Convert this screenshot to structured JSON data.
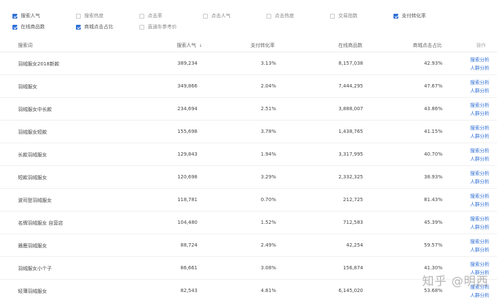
{
  "filters": [
    {
      "label": "搜索人气",
      "checked": true
    },
    {
      "label": "搜索热度",
      "checked": false
    },
    {
      "label": "点击率",
      "checked": false
    },
    {
      "label": "点击人气",
      "checked": false
    },
    {
      "label": "点击热度",
      "checked": false
    },
    {
      "label": "交易指数",
      "checked": false
    },
    {
      "label": "支付转化率",
      "checked": true
    },
    {
      "label": "在线商品数",
      "checked": true
    },
    {
      "label": "商城点击占比",
      "checked": true
    },
    {
      "label": "直通车参考价",
      "checked": false
    }
  ],
  "table": {
    "headers": {
      "keyword": "搜索词",
      "popularity": "搜索人气",
      "conversion": "支付转化率",
      "online_items": "在线商品数",
      "mall_click": "商城点击占比",
      "ops": "操作"
    },
    "rows": [
      {
        "keyword": "羽绒服女2018新款",
        "popularity": "389,234",
        "conversion": "3.13%",
        "online_items": "8,157,038",
        "mall_click": "42.93%"
      },
      {
        "keyword": "羽绒服女",
        "popularity": "349,866",
        "conversion": "2.04%",
        "online_items": "7,444,295",
        "mall_click": "47.67%"
      },
      {
        "keyword": "羽绒服女中长款",
        "popularity": "234,694",
        "conversion": "2.51%",
        "online_items": "3,888,007",
        "mall_click": "43.86%"
      },
      {
        "keyword": "羽绒服女短款",
        "popularity": "155,698",
        "conversion": "3.78%",
        "online_items": "1,438,765",
        "mall_click": "41.15%"
      },
      {
        "keyword": "长款羽绒服女",
        "popularity": "129,843",
        "conversion": "1.94%",
        "online_items": "3,317,995",
        "mall_click": "40.70%"
      },
      {
        "keyword": "短款羽绒服女",
        "popularity": "120,698",
        "conversion": "3.29%",
        "online_items": "2,332,325",
        "mall_click": "38.93%"
      },
      {
        "keyword": "波司登羽绒服女",
        "popularity": "118,781",
        "conversion": "0.70%",
        "online_items": "212,725",
        "mall_click": "81.43%"
      },
      {
        "keyword": "名牌羽绒服女 自营店",
        "popularity": "104,480",
        "conversion": "1.52%",
        "online_items": "712,583",
        "mall_click": "45.39%"
      },
      {
        "keyword": "雅鹿羽绒服女",
        "popularity": "88,724",
        "conversion": "2.49%",
        "online_items": "42,254",
        "mall_click": "59.57%"
      },
      {
        "keyword": "羽绒服女小个子",
        "popularity": "86,661",
        "conversion": "3.08%",
        "online_items": "156,874",
        "mall_click": "41.30%"
      },
      {
        "keyword": "轻薄羽绒服女",
        "popularity": "82,543",
        "conversion": "4.81%",
        "online_items": "6,145,020",
        "mall_click": "53.68%"
      }
    ],
    "op_labels": {
      "search_analysis": "搜索分析",
      "crowd_analysis": "人群分析"
    }
  },
  "watermark": "知乎 @明西",
  "colors": {
    "accent": "#2f6fd6",
    "checkbox_checked": "#2f6fd6",
    "link": "#2f6fd6"
  }
}
